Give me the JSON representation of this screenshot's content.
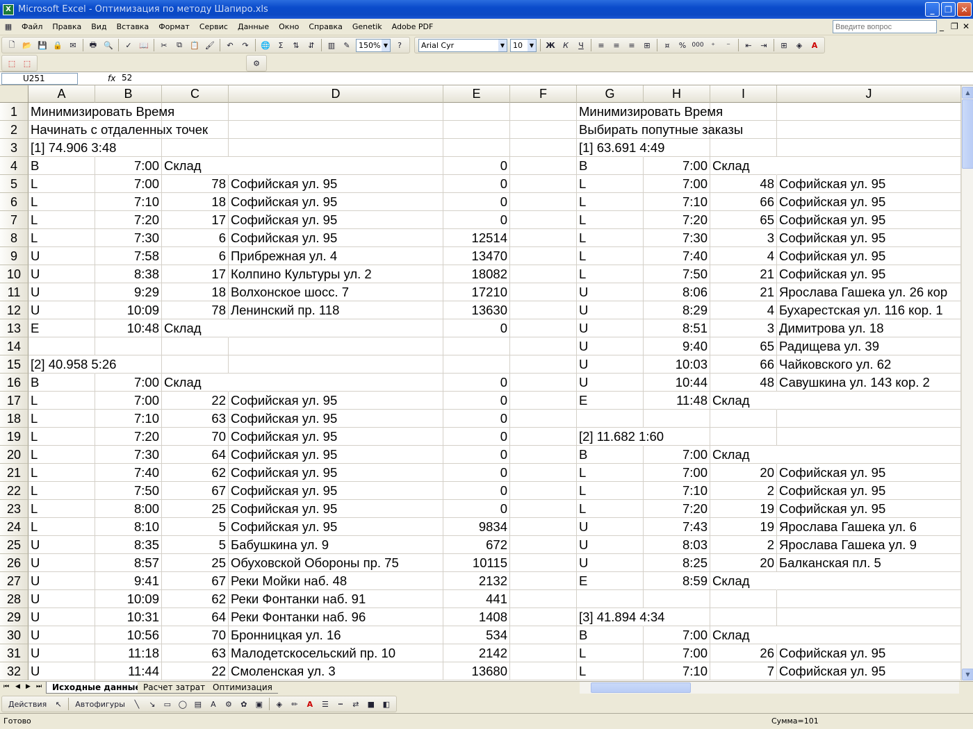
{
  "window": {
    "title": "Microsoft Excel - Оптимизация по методу Шапиро.xls"
  },
  "menu": [
    "Файл",
    "Правка",
    "Вид",
    "Вставка",
    "Формат",
    "Сервис",
    "Данные",
    "Окно",
    "Справка",
    "Genetik",
    "Adobe PDF"
  ],
  "help": {
    "placeholder": "Введите вопрос"
  },
  "toolbar": {
    "zoom": "150%",
    "font": "Arial Cyr",
    "size": "10",
    "bold": "Ж",
    "italic": "К",
    "underline": "Ч",
    "percent": "%",
    "thousands": "000"
  },
  "formula": {
    "namebox": "U251",
    "fx": "fx",
    "value": "52"
  },
  "columns": [
    "A",
    "B",
    "C",
    "D",
    "E",
    "F",
    "G",
    "H",
    "I",
    "J"
  ],
  "rows": [
    [
      "Минимизировать Время",
      "",
      "",
      "",
      "",
      "",
      "Минимизировать Время",
      "",
      "",
      ""
    ],
    [
      "Начинать с отдаленных точек",
      "",
      "",
      "",
      "",
      "",
      "Выбирать попутные заказы",
      "",
      "",
      ""
    ],
    [
      "[1] 74.906 3:48",
      "",
      "",
      "",
      "",
      "",
      "[1] 63.691 4:49",
      "",
      "",
      ""
    ],
    [
      "B",
      "7:00",
      "Склад",
      "",
      "0",
      "",
      "B",
      "7:00",
      "Склад",
      ""
    ],
    [
      "L",
      "7:00",
      "78",
      "Софийская ул. 95",
      "0",
      "",
      "L",
      "7:00",
      "48",
      "Софийская ул. 95"
    ],
    [
      "L",
      "7:10",
      "18",
      "Софийская ул. 95",
      "0",
      "",
      "L",
      "7:10",
      "66",
      "Софийская ул. 95"
    ],
    [
      "L",
      "7:20",
      "17",
      "Софийская ул. 95",
      "0",
      "",
      "L",
      "7:20",
      "65",
      "Софийская ул. 95"
    ],
    [
      "L",
      "7:30",
      "6",
      "Софийская ул. 95",
      "12514",
      "",
      "L",
      "7:30",
      "3",
      "Софийская ул. 95"
    ],
    [
      "U",
      "7:58",
      "6",
      "Прибрежная ул. 4",
      "13470",
      "",
      "L",
      "7:40",
      "4",
      "Софийская ул. 95"
    ],
    [
      "U",
      "8:38",
      "17",
      "Колпино Культуры ул. 2",
      "18082",
      "",
      "L",
      "7:50",
      "21",
      "Софийская ул. 95"
    ],
    [
      "U",
      "9:29",
      "18",
      "Волхонское шосс. 7",
      "17210",
      "",
      "U",
      "8:06",
      "21",
      "Ярослава Гашека ул. 26 кор"
    ],
    [
      "U",
      "10:09",
      "78",
      "Ленинский пр. 118",
      "13630",
      "",
      "U",
      "8:29",
      "4",
      "Бухарестская ул. 116 кор. 1"
    ],
    [
      "E",
      "10:48",
      "Склад",
      "",
      "0",
      "",
      "U",
      "8:51",
      "3",
      "Димитрова ул. 18"
    ],
    [
      "",
      "",
      "",
      "",
      "",
      "",
      "U",
      "9:40",
      "65",
      "Радищева ул. 39"
    ],
    [
      "[2] 40.958 5:26",
      "",
      "",
      "",
      "",
      "",
      "U",
      "10:03",
      "66",
      "Чайковского ул. 62"
    ],
    [
      "B",
      "7:00",
      "Склад",
      "",
      "0",
      "",
      "U",
      "10:44",
      "48",
      "Савушкина ул. 143 кор. 2"
    ],
    [
      "L",
      "7:00",
      "22",
      "Софийская ул. 95",
      "0",
      "",
      "E",
      "11:48",
      "Склад",
      ""
    ],
    [
      "L",
      "7:10",
      "63",
      "Софийская ул. 95",
      "0",
      "",
      "",
      "",
      "",
      ""
    ],
    [
      "L",
      "7:20",
      "70",
      "Софийская ул. 95",
      "0",
      "",
      "[2] 11.682 1:60",
      "",
      "",
      ""
    ],
    [
      "L",
      "7:30",
      "64",
      "Софийская ул. 95",
      "0",
      "",
      "B",
      "7:00",
      "Склад",
      ""
    ],
    [
      "L",
      "7:40",
      "62",
      "Софийская ул. 95",
      "0",
      "",
      "L",
      "7:00",
      "20",
      "Софийская ул. 95"
    ],
    [
      "L",
      "7:50",
      "67",
      "Софийская ул. 95",
      "0",
      "",
      "L",
      "7:10",
      "2",
      "Софийская ул. 95"
    ],
    [
      "L",
      "8:00",
      "25",
      "Софийская ул. 95",
      "0",
      "",
      "L",
      "7:20",
      "19",
      "Софийская ул. 95"
    ],
    [
      "L",
      "8:10",
      "5",
      "Софийская ул. 95",
      "9834",
      "",
      "U",
      "7:43",
      "19",
      "Ярослава Гашека ул. 6"
    ],
    [
      "U",
      "8:35",
      "5",
      "Бабушкина ул. 9",
      "672",
      "",
      "U",
      "8:03",
      "2",
      "Ярослава Гашека ул. 9"
    ],
    [
      "U",
      "8:57",
      "25",
      "Обуховской Обороны пр. 75",
      "10115",
      "",
      "U",
      "8:25",
      "20",
      "Балканская пл. 5"
    ],
    [
      "U",
      "9:41",
      "67",
      "Реки Мойки наб. 48",
      "2132",
      "",
      "E",
      "8:59",
      "Склад",
      ""
    ],
    [
      "U",
      "10:09",
      "62",
      "Реки Фонтанки наб. 91",
      "441",
      "",
      "",
      "",
      "",
      ""
    ],
    [
      "U",
      "10:31",
      "64",
      "Реки Фонтанки наб. 96",
      "1408",
      "",
      "[3] 41.894 4:34",
      "",
      "",
      ""
    ],
    [
      "U",
      "10:56",
      "70",
      "Бронницкая ул. 16",
      "534",
      "",
      "B",
      "7:00",
      "Склад",
      ""
    ],
    [
      "U",
      "11:18",
      "63",
      "Малодетскосельский пр. 10",
      "2142",
      "",
      "L",
      "7:00",
      "26",
      "Софийская ул. 95"
    ],
    [
      "U",
      "11:44",
      "22",
      "Смоленская ул. 3",
      "13680",
      "",
      "L",
      "7:10",
      "7",
      "Софийская ул. 95"
    ]
  ],
  "sheets": [
    "Исходные данные",
    "Расчет затрат",
    "Оптимизация"
  ],
  "drawing": {
    "actions": "Действия",
    "autoshapes": "Автофигуры"
  },
  "status": {
    "ready": "Готово",
    "sum": "Сумма=101"
  }
}
